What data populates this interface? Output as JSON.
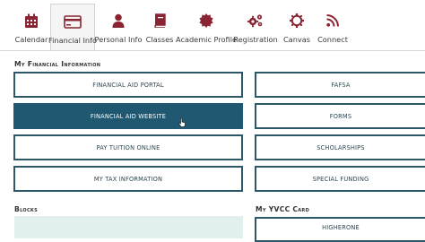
{
  "nav": {
    "tabs": [
      {
        "label": "Calendar",
        "icon": "calendar-icon"
      },
      {
        "label": "Financial Info",
        "icon": "credit-card-icon",
        "active": true
      },
      {
        "label": "Personal Info",
        "icon": "person-icon"
      },
      {
        "label": "Classes",
        "icon": "book-icon"
      },
      {
        "label": "Academic Profile",
        "icon": "seal-icon"
      },
      {
        "label": "Registration",
        "icon": "gears-icon"
      },
      {
        "label": "Canvas",
        "icon": "compass-icon"
      },
      {
        "label": "Connect",
        "icon": "rss-icon"
      }
    ],
    "icon_color": "#8a2432"
  },
  "financial": {
    "title": "My Financial Information",
    "left_buttons": [
      "FINANCIAL AID PORTAL",
      "FINANCIAL AID WEBSITE",
      "PAY TUITION ONLINE",
      "MY TAX INFORMATION"
    ],
    "right_buttons": [
      "FAFSA",
      "FORMS",
      "SCHOLARSHIPS",
      "SPECIAL FUNDING"
    ],
    "selected": "FINANCIAL AID WEBSITE"
  },
  "blocks": {
    "title": "Blocks"
  },
  "yvcc_card": {
    "title": "My YVCC Card",
    "buttons": [
      "HIGHERONE"
    ]
  },
  "colors": {
    "accent": "#1f5870",
    "border": "#2d5666",
    "icon": "#8a2432",
    "blocks_bg": "#e2efef"
  }
}
